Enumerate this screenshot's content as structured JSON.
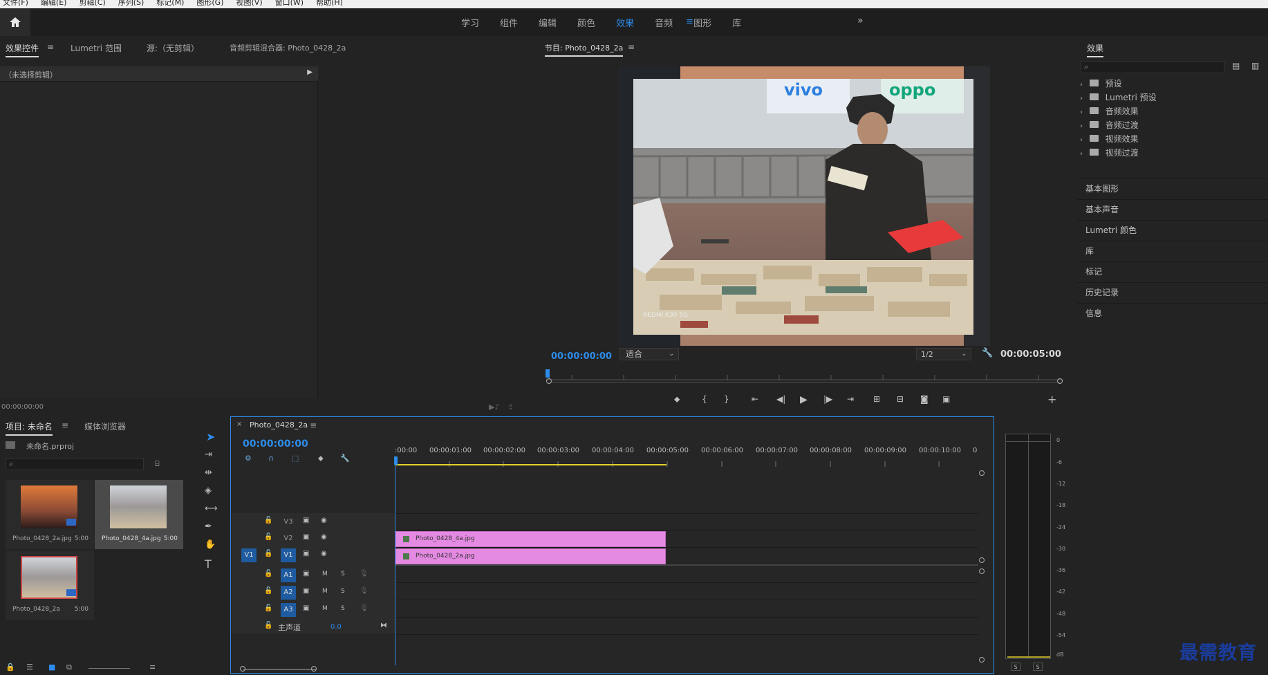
{
  "menubar": {
    "items": [
      "文件(F)",
      "编辑(E)",
      "剪辑(C)",
      "序列(S)",
      "标记(M)",
      "图形(G)",
      "视图(V)",
      "窗口(W)",
      "帮助(H)"
    ]
  },
  "workspaces": {
    "tabs": [
      "学习",
      "组件",
      "编辑",
      "颜色",
      "效果",
      "音频",
      "图形",
      "库"
    ],
    "active_index": 4
  },
  "effect_controls": {
    "tabs": [
      "效果控件",
      "Lumetri 范围",
      "源:（无剪辑）",
      "音频剪辑混合器: Photo_0428_2a"
    ],
    "no_clip_label": "（未选择剪辑）",
    "timecode": "00:00:00:00"
  },
  "program": {
    "title": "节目: Photo_0428_2a",
    "timecode": "00:00:00:00",
    "fit": "适合",
    "resolution": "1/2",
    "duration": "00:00:05:00",
    "watermark": "REDMI K30 5G"
  },
  "project": {
    "tabs": [
      "项目: 未命名",
      "媒体浏览器"
    ],
    "file": "未命名.prproj",
    "items": [
      {
        "name": "Photo_0428_2a.jpg",
        "dur": "5:00"
      },
      {
        "name": "Photo_0428_4a.jpg",
        "dur": "5:00"
      },
      {
        "name": "Photo_0428_2a",
        "dur": "5:00"
      }
    ]
  },
  "timeline": {
    "sequence_tab": "Photo_0428_2a",
    "timecode": "00:00:00:00",
    "ruler": [
      ":00:00",
      "00:00:01:00",
      "00:00:02:00",
      "00:00:03:00",
      "00:00:04:00",
      "00:00:05:00",
      "00:00:06:00",
      "00:00:07:00",
      "00:00:08:00",
      "00:00:09:00",
      "00:00:10:00",
      "0"
    ],
    "video_tracks": [
      "V3",
      "V2",
      "V1"
    ],
    "audio_tracks": [
      "A1",
      "A2",
      "A3"
    ],
    "source_patch": "V1",
    "master_label": "主声道",
    "master_value": "0.0",
    "clip_v2": "Photo_0428_4a.jpg",
    "clip_v1": "Photo_0428_2a.jpg",
    "m_label": "M",
    "s_label": "S"
  },
  "effects_panel": {
    "title": "效果",
    "items": [
      "预设",
      "Lumetri 预设",
      "音频效果",
      "音频过渡",
      "视频效果",
      "视频过渡"
    ]
  },
  "side_panels": [
    "基本图形",
    "基本声音",
    "Lumetri 颜色",
    "库",
    "标记",
    "历史记录",
    "信息"
  ],
  "meter": {
    "ticks": [
      "0",
      "-6",
      "-12",
      "-18",
      "-24",
      "-30",
      "-36",
      "-42",
      "-48",
      "-54",
      "dB"
    ],
    "solo": [
      "S",
      "S"
    ]
  },
  "brand": {
    "logo_text": "最需教育",
    "accent": "#2d8ceb",
    "clip_color": "#e58ae3"
  }
}
